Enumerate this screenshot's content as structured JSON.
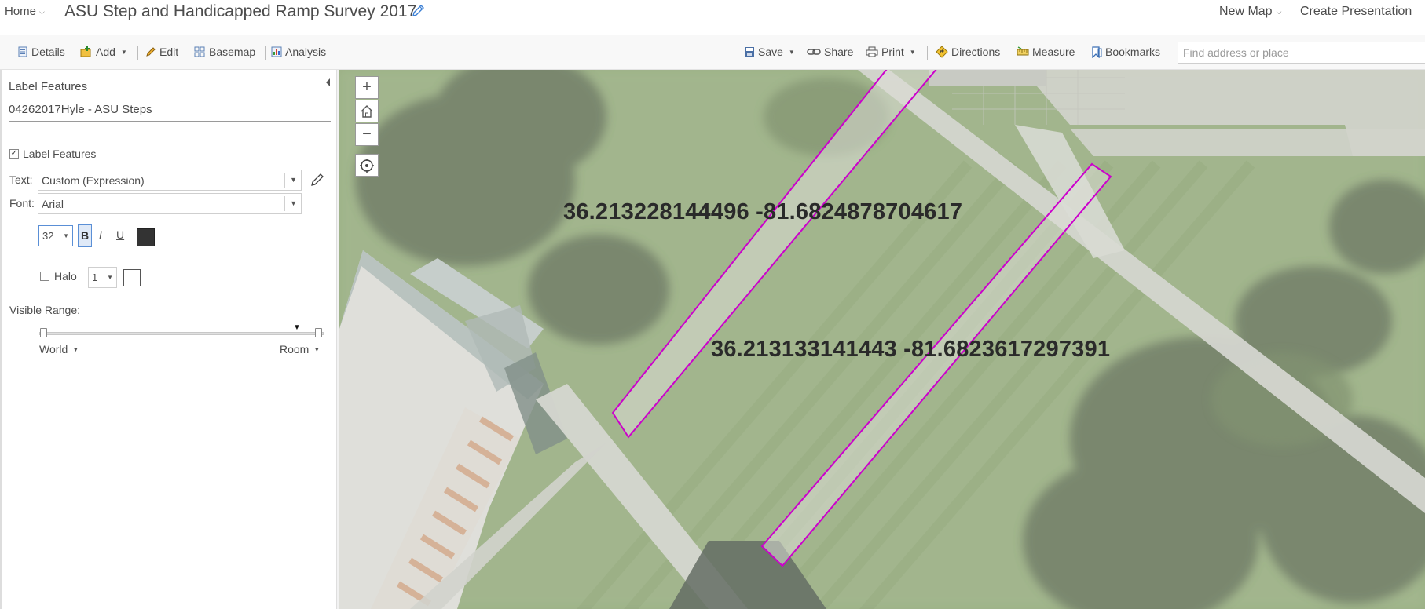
{
  "header": {
    "home_label": "Home",
    "map_title": "ASU Step and Handicapped Ramp Survey 2017",
    "new_map_label": "New Map",
    "create_presentation_label": "Create Presentation"
  },
  "toolbar": {
    "details": "Details",
    "add": "Add",
    "edit": "Edit",
    "basemap": "Basemap",
    "analysis": "Analysis",
    "save": "Save",
    "share": "Share",
    "print": "Print",
    "directions": "Directions",
    "measure": "Measure",
    "bookmarks": "Bookmarks",
    "search_placeholder": "Find address or place"
  },
  "panel": {
    "heading": "Label Features",
    "layer_name": "04262017Hyle - ASU Steps",
    "label_features_checkbox": "Label Features",
    "label_features_checked": true,
    "text_label": "Text:",
    "text_value": "Custom (Expression)",
    "font_label": "Font:",
    "font_value": "Arial",
    "font_size": "32",
    "bold": "B",
    "italic": "I",
    "underline": "U",
    "text_color": "#333333",
    "halo_label": "Halo",
    "halo_checked": false,
    "halo_size": "1",
    "halo_color": "#ffffff",
    "visible_range_label": "Visible Range:",
    "range_min": "World",
    "range_max": "Room"
  },
  "map": {
    "zoom_in": "+",
    "zoom_out": "−",
    "feature_outline_color": "#cc00cc",
    "labels": [
      "36.213228144496 -81.6824878704617",
      "36.213133141443 -81.6823617297391"
    ]
  }
}
